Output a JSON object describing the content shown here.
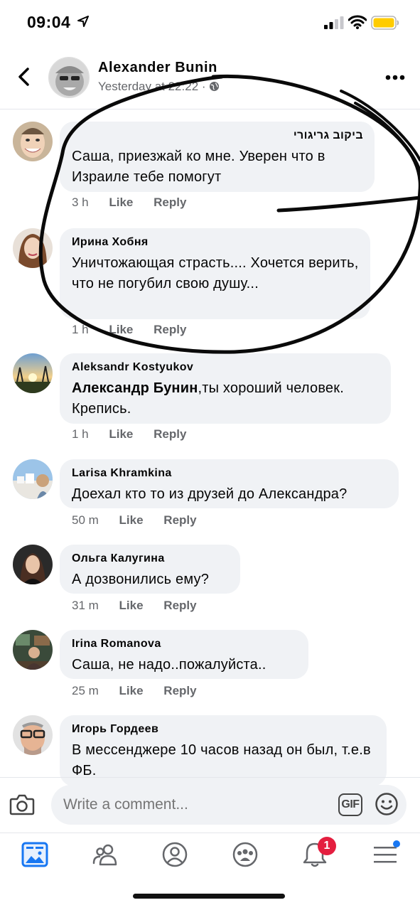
{
  "status_bar": {
    "time": "09:04"
  },
  "post": {
    "author": "Alexander  Bunin",
    "time": "Yesterday at 22:22",
    "separator": "·"
  },
  "comments": [
    {
      "author": "ביקוב גריגורי",
      "text": "Саша, приезжай ко мне. Уверен что в Израиле тебе помогут",
      "time": "3 h"
    },
    {
      "author": "Ирина Хобня",
      "text": "Уничтожающая страсть.... Хочется верить, что не погубил свою душу...",
      "time": "1 h"
    },
    {
      "author": "Aleksandr Kostyukov",
      "mention": "Александр Бунин",
      "text": ",ты хороший человек. Крепись.",
      "time": "1 h"
    },
    {
      "author": "Larisa Khramkina",
      "text": "Доехал кто то из друзей до Александра?",
      "time": "50 m"
    },
    {
      "author": "Ольга Калугина",
      "text": "А дозвонились ему?",
      "time": "31 m"
    },
    {
      "author": "Irina  Romanova",
      "text": "Саша,  не надо..пожалуйста..",
      "time": "25 m"
    },
    {
      "author": "Игорь Гордеев",
      "text": "В мессенджере 10 часов назад он был, т.е.в ФБ.",
      "time": ""
    }
  ],
  "actions": {
    "like": "Like",
    "reply": "Reply"
  },
  "composer": {
    "placeholder": "Write a comment...",
    "gif_label": "GIF"
  },
  "tab_bar": {
    "notifications_badge": "1"
  },
  "colors": {
    "accent": "#1877f2",
    "badge": "#e41e3f",
    "bubble": "#f0f2f5",
    "meta_text": "#65676b",
    "battery": "#ffcc00"
  }
}
